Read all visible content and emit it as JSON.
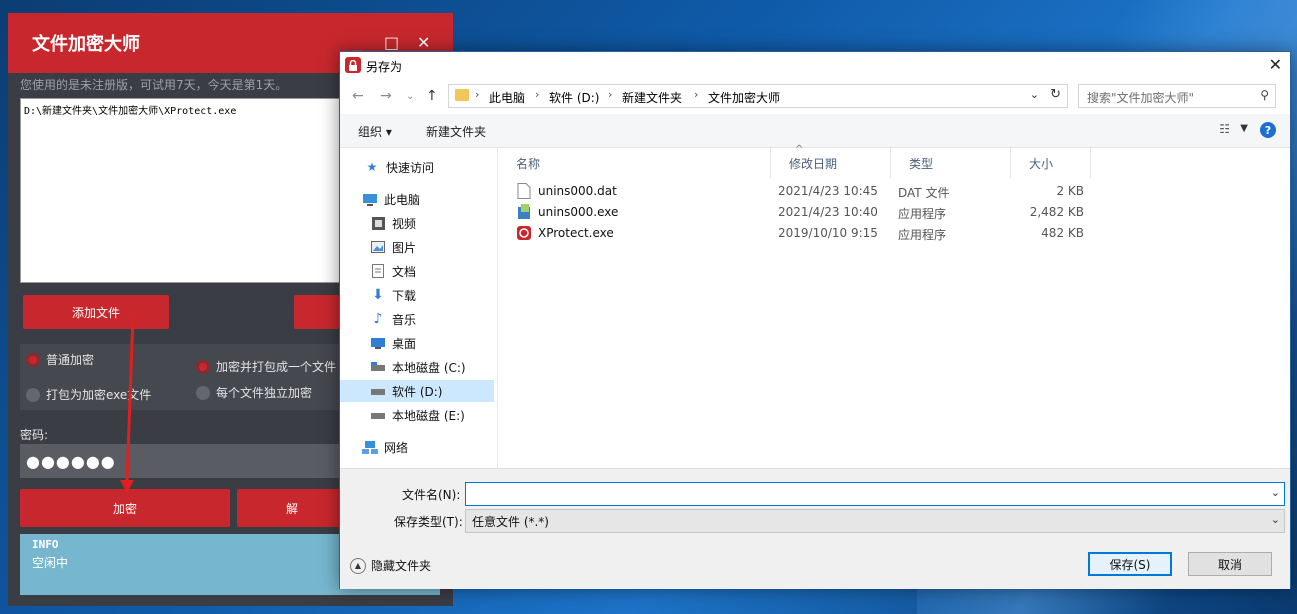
{
  "app": {
    "title": "文件加密大师",
    "window_buttons": [
      "_",
      "□",
      "✕"
    ],
    "notice": "您使用的是未注册版，可试用7天，今天是第1天。",
    "file_list": [
      "D:\\新建文件夹\\文件加密大师\\XProtect.exe"
    ],
    "add_file_label": "添加文件",
    "options": [
      {
        "label": "普通加密",
        "checked": true
      },
      {
        "label": "打包为加密exe文件",
        "checked": false
      },
      {
        "label": "加密并打包成一个文件",
        "checked": true
      },
      {
        "label": "每个文件独立加密",
        "checked": false
      }
    ],
    "password_label": "密码:",
    "password_value": "●●●●●●",
    "encrypt_label": "加密",
    "decrypt_label": "解",
    "info_title": "INFO",
    "info_status": "空闲中",
    "accent_color": "#c8282d"
  },
  "dialog": {
    "title": "另存为",
    "close": "✕",
    "breadcrumb": [
      "此电脑",
      "软件 (D:)",
      "新建文件夹",
      "文件加密大师"
    ],
    "search_placeholder": "搜索\"文件加密大师\"",
    "toolbar": {
      "organize": "组织 ▾",
      "new_folder": "新建文件夹",
      "help": "?"
    },
    "nav_items": [
      {
        "label": "快速访问",
        "icon": "star-icon",
        "selected": false
      },
      {
        "label": "此电脑",
        "icon": "computer-icon",
        "selected": false
      },
      {
        "label": "视频",
        "icon": "video-icon",
        "selected": false
      },
      {
        "label": "图片",
        "icon": "image-icon",
        "selected": false
      },
      {
        "label": "文档",
        "icon": "document-icon",
        "selected": false
      },
      {
        "label": "下载",
        "icon": "download-icon",
        "selected": false
      },
      {
        "label": "音乐",
        "icon": "music-icon",
        "selected": false
      },
      {
        "label": "桌面",
        "icon": "desktop-icon",
        "selected": false
      },
      {
        "label": "本地磁盘 (C:)",
        "icon": "drive-icon",
        "selected": false
      },
      {
        "label": "软件 (D:)",
        "icon": "drive-icon",
        "selected": true
      },
      {
        "label": "本地磁盘 (E:)",
        "icon": "drive-icon",
        "selected": false
      },
      {
        "label": "网络",
        "icon": "network-icon",
        "selected": false
      }
    ],
    "columns": [
      "名称",
      "修改日期",
      "类型",
      "大小"
    ],
    "files": [
      {
        "name": "unins000.dat",
        "date": "2021/4/23 10:45",
        "type": "DAT 文件",
        "size": "2 KB",
        "icon": "file-icon"
      },
      {
        "name": "unins000.exe",
        "date": "2021/4/23 10:40",
        "type": "应用程序",
        "size": "2,482 KB",
        "icon": "installer-icon"
      },
      {
        "name": "XProtect.exe",
        "date": "2019/10/10 9:15",
        "type": "应用程序",
        "size": "482 KB",
        "icon": "lock-app-icon"
      }
    ],
    "filename_label": "文件名(N):",
    "filename_value": "",
    "filetype_label": "保存类型(T):",
    "filetype_value": "任意文件 (*.*)",
    "hide_folders_label": "隐藏文件夹",
    "save_label": "保存(S)",
    "cancel_label": "取消"
  }
}
